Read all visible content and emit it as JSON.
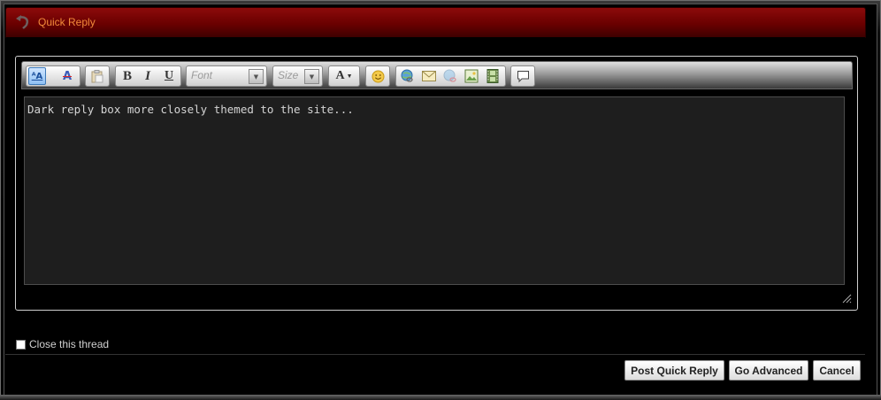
{
  "header": {
    "title": "Quick Reply"
  },
  "editor": {
    "toolbar": {
      "font_placeholder": "Font",
      "size_placeholder": "Size",
      "bold": "B",
      "italic": "I",
      "underline": "U",
      "text_color": "A"
    },
    "text": "Dark reply box more closely themed to the site..."
  },
  "options": {
    "close_thread_label": "Close this thread",
    "close_thread_checked": false
  },
  "buttons": {
    "post": "Post Quick Reply",
    "advanced": "Go Advanced",
    "cancel": "Cancel"
  },
  "colors": {
    "header_red": "#7a0000",
    "title_orange": "#f08a3a",
    "editor_bg": "#1e1e1e"
  },
  "icons": [
    "back-arrow-icon",
    "switch-editor-mode-icon",
    "remove-format-icon",
    "paste-icon",
    "bold-icon",
    "italic-icon",
    "underline-icon",
    "font-dropdown-icon",
    "size-dropdown-icon",
    "text-color-icon",
    "smiley-icon",
    "link-icon",
    "email-icon",
    "unlink-icon",
    "image-icon",
    "video-icon",
    "quote-icon",
    "resize-grip-icon"
  ]
}
